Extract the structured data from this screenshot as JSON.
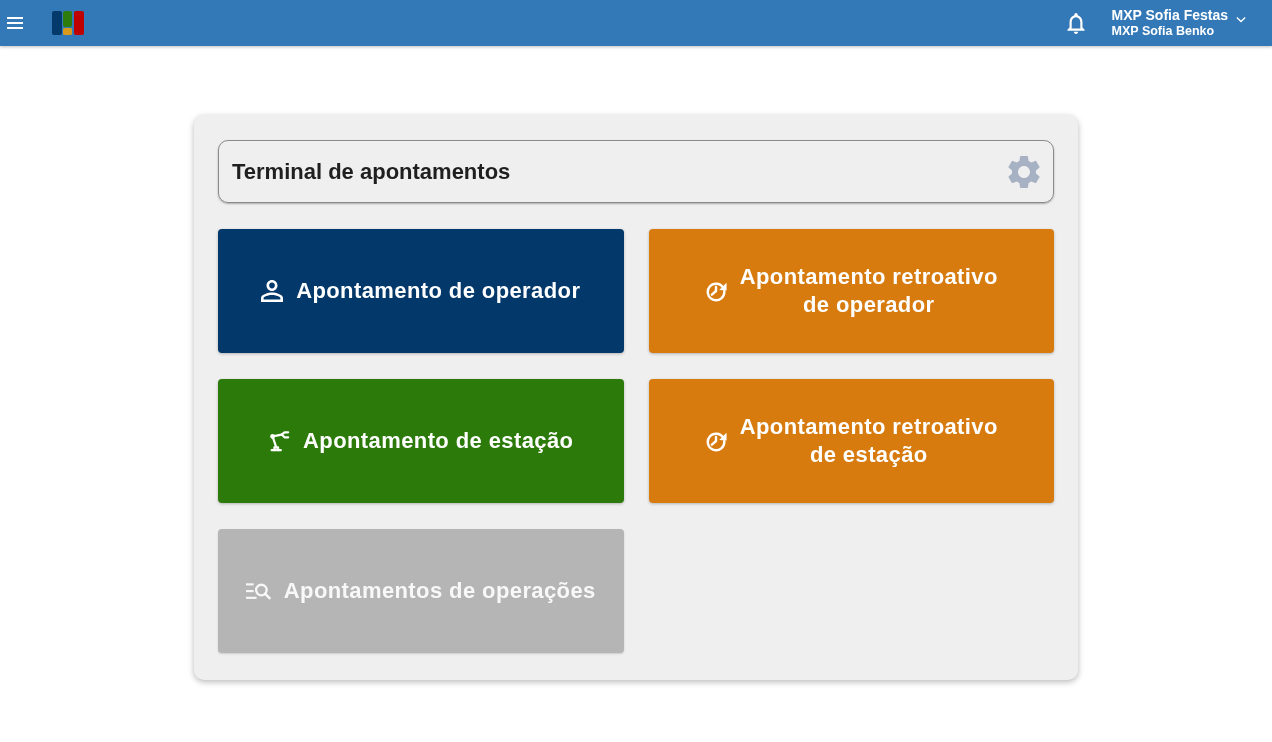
{
  "header": {
    "user_name": "MXP Sofia Festas",
    "user_subtitle": "MXP Sofia Benko"
  },
  "panel": {
    "title": "Terminal de apontamentos"
  },
  "tiles": [
    {
      "kind": "operator",
      "label": "Apontamento de operador",
      "color": "#03386a",
      "disabled": false
    },
    {
      "kind": "retroactive",
      "label": "Apontamento retroativo\nde operador",
      "color": "#d87b0f",
      "disabled": false
    },
    {
      "kind": "station",
      "label": "Apontamento de estação",
      "color": "#2c7a0a",
      "disabled": false
    },
    {
      "kind": "retroactive",
      "label": "Apontamento retroativo\nde estação",
      "color": "#d87b0f",
      "disabled": false
    },
    {
      "kind": "query",
      "label": "Apontamentos de operações",
      "color": "#b5b5b5",
      "disabled": true
    }
  ]
}
